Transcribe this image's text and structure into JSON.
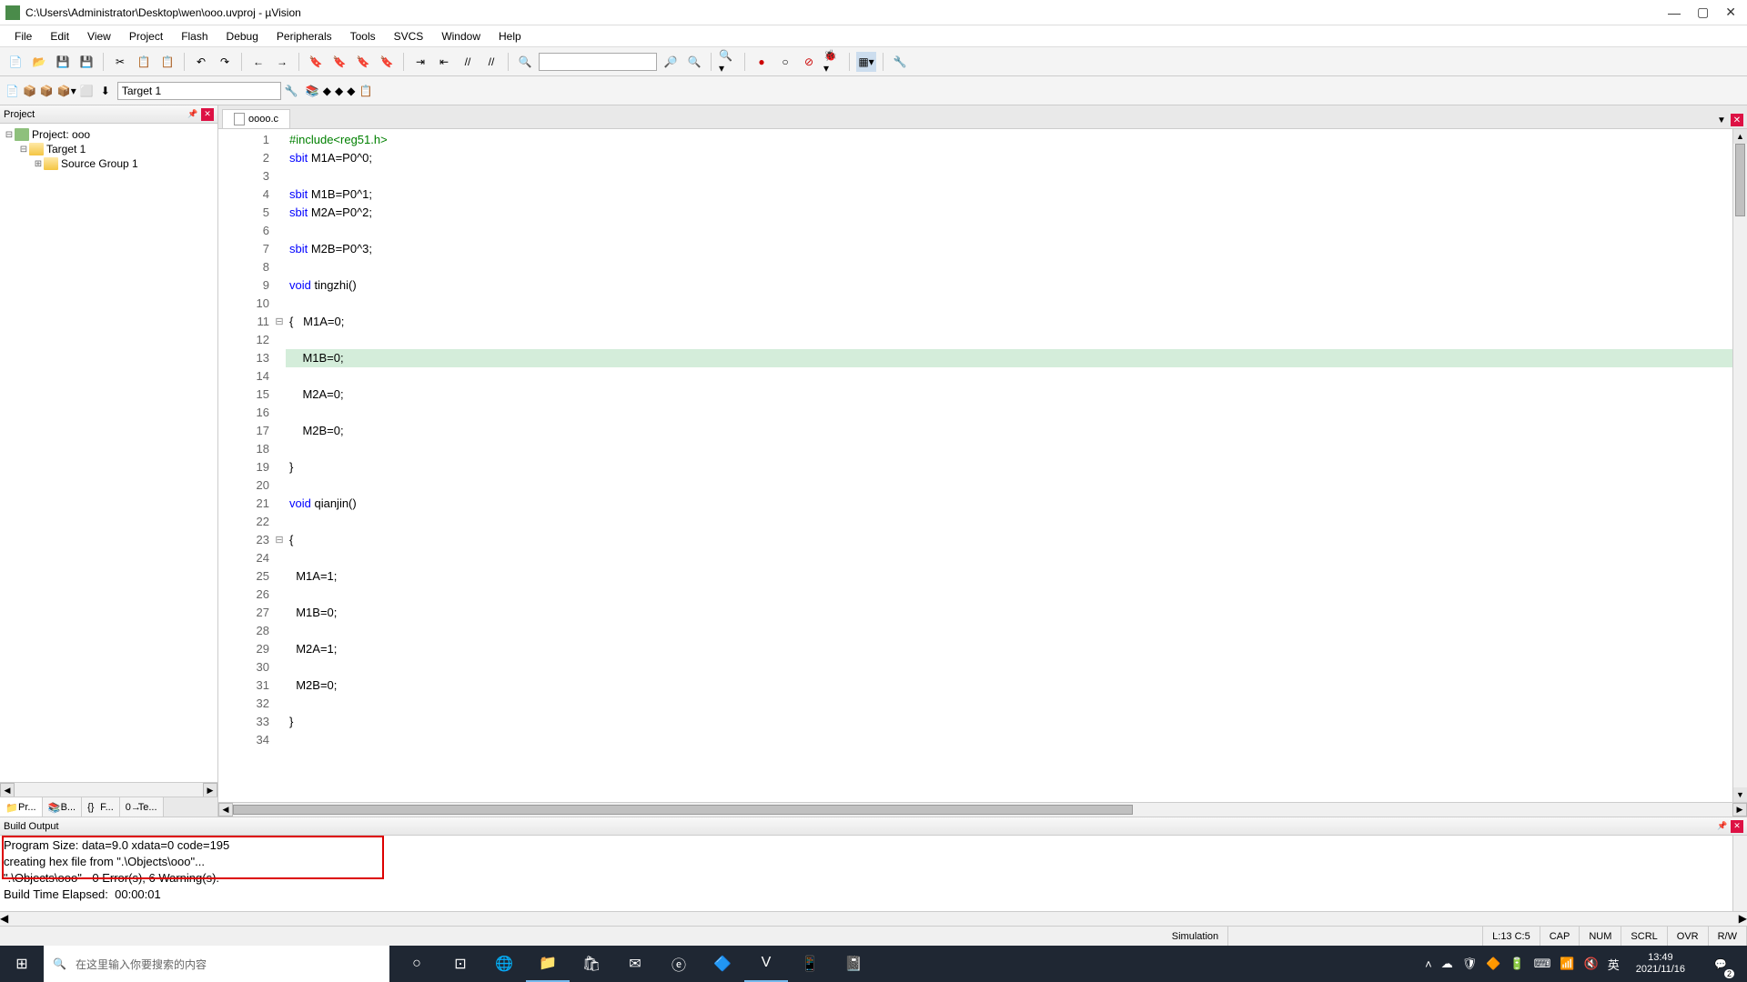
{
  "window": {
    "title": "C:\\Users\\Administrator\\Desktop\\wen\\ooo.uvproj - µVision"
  },
  "menu": {
    "items": [
      "File",
      "Edit",
      "View",
      "Project",
      "Flash",
      "Debug",
      "Peripherals",
      "Tools",
      "SVCS",
      "Window",
      "Help"
    ]
  },
  "toolbar2": {
    "target": "Target 1"
  },
  "project_panel": {
    "title": "Project",
    "tree": {
      "root": "Project: ooo",
      "target": "Target 1",
      "group": "Source Group 1"
    },
    "tabs": [
      "Pr...",
      "B...",
      "F...",
      "Te..."
    ]
  },
  "editor": {
    "tab_name": "oooo.c",
    "lines": [
      {
        "n": 1,
        "fold": "",
        "cls": "",
        "html": "<span class='pp'>#include&lt;reg51.h&gt;</span>"
      },
      {
        "n": 2,
        "fold": "",
        "cls": "",
        "html": "<span class='kw'>sbit</span> M1A=P0^0;"
      },
      {
        "n": 3,
        "fold": "",
        "cls": "",
        "html": ""
      },
      {
        "n": 4,
        "fold": "",
        "cls": "",
        "html": "<span class='kw'>sbit</span> M1B=P0^1;"
      },
      {
        "n": 5,
        "fold": "",
        "cls": "",
        "html": "<span class='kw'>sbit</span> M2A=P0^2;"
      },
      {
        "n": 6,
        "fold": "",
        "cls": "",
        "html": ""
      },
      {
        "n": 7,
        "fold": "",
        "cls": "",
        "html": "<span class='kw'>sbit</span> M2B=P0^3;"
      },
      {
        "n": 8,
        "fold": "",
        "cls": "",
        "html": ""
      },
      {
        "n": 9,
        "fold": "",
        "cls": "",
        "html": "<span class='kw'>void</span> tingzhi()"
      },
      {
        "n": 10,
        "fold": "",
        "cls": "",
        "html": ""
      },
      {
        "n": 11,
        "fold": "⊟",
        "cls": "",
        "html": "{   M1A=0;"
      },
      {
        "n": 12,
        "fold": "",
        "cls": "",
        "html": ""
      },
      {
        "n": 13,
        "fold": "",
        "cls": "highlight",
        "html": "    M1B=0;"
      },
      {
        "n": 14,
        "fold": "",
        "cls": "",
        "html": ""
      },
      {
        "n": 15,
        "fold": "",
        "cls": "",
        "html": "    M2A=0;"
      },
      {
        "n": 16,
        "fold": "",
        "cls": "",
        "html": ""
      },
      {
        "n": 17,
        "fold": "",
        "cls": "",
        "html": "    M2B=0;"
      },
      {
        "n": 18,
        "fold": "",
        "cls": "",
        "html": ""
      },
      {
        "n": 19,
        "fold": "",
        "cls": "",
        "html": "}"
      },
      {
        "n": 20,
        "fold": "",
        "cls": "",
        "html": ""
      },
      {
        "n": 21,
        "fold": "",
        "cls": "",
        "html": "<span class='kw'>void</span> qianjin()"
      },
      {
        "n": 22,
        "fold": "",
        "cls": "",
        "html": ""
      },
      {
        "n": 23,
        "fold": "⊟",
        "cls": "",
        "html": "{"
      },
      {
        "n": 24,
        "fold": "",
        "cls": "",
        "html": ""
      },
      {
        "n": 25,
        "fold": "",
        "cls": "",
        "html": "  M1A=1;"
      },
      {
        "n": 26,
        "fold": "",
        "cls": "",
        "html": ""
      },
      {
        "n": 27,
        "fold": "",
        "cls": "",
        "html": "  M1B=0;"
      },
      {
        "n": 28,
        "fold": "",
        "cls": "",
        "html": ""
      },
      {
        "n": 29,
        "fold": "",
        "cls": "",
        "html": "  M2A=1;"
      },
      {
        "n": 30,
        "fold": "",
        "cls": "",
        "html": ""
      },
      {
        "n": 31,
        "fold": "",
        "cls": "",
        "html": "  M2B=0;"
      },
      {
        "n": 32,
        "fold": "",
        "cls": "",
        "html": ""
      },
      {
        "n": 33,
        "fold": "",
        "cls": "",
        "html": "}"
      },
      {
        "n": 34,
        "fold": "",
        "cls": "",
        "html": ""
      }
    ]
  },
  "build_output": {
    "title": "Build Output",
    "lines": [
      "Program Size: data=9.0 xdata=0 code=195",
      "creating hex file from \".\\Objects\\ooo\"...",
      "\".\\Objects\\ooo\" - 0 Error(s), 6 Warning(s).",
      "Build Time Elapsed:  00:00:01"
    ]
  },
  "status_bar": {
    "sim": "Simulation",
    "cursor": "L:13 C:5",
    "caps": "CAP",
    "num": "NUM",
    "scrl": "SCRL",
    "ovr": "OVR",
    "rw": "R/W"
  },
  "taskbar": {
    "search_placeholder": "在这里输入你要搜索的内容",
    "ime": "英",
    "time": "13:49",
    "date": "2021/11/16",
    "notif_count": "2"
  }
}
